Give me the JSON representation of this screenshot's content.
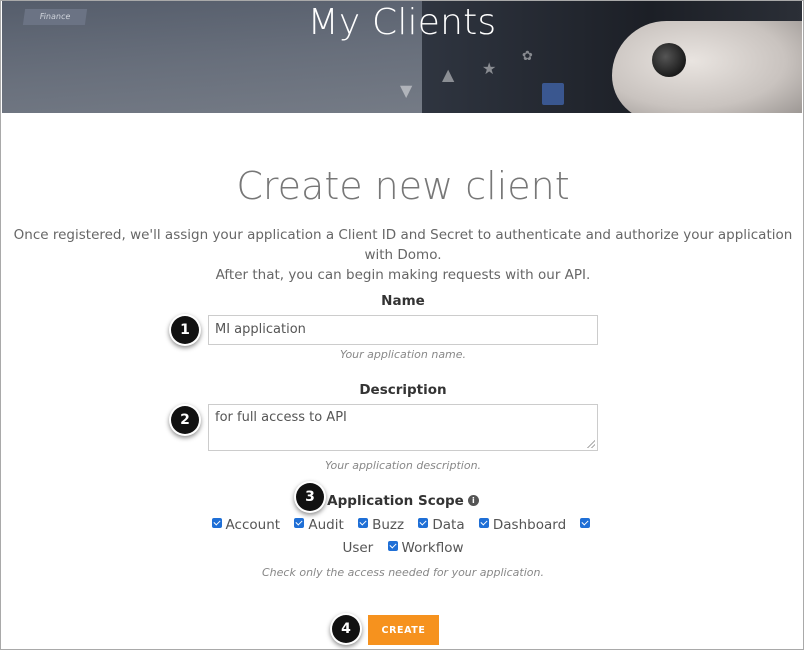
{
  "header": {
    "title": "My Clients",
    "tag": "Finance"
  },
  "form": {
    "title": "Create new client",
    "intro_line1": "Once registered, we'll assign your application a Client ID and Secret to authenticate and authorize your application with Domo.",
    "intro_line2": "After that, you can begin making requests with our API.",
    "name": {
      "label": "Name",
      "value": "MI application",
      "hint": "Your application name."
    },
    "description": {
      "label": "Description",
      "value": "for full access to API",
      "hint": "Your application description."
    },
    "scope": {
      "label": "Application Scope",
      "items": [
        "Account",
        "Audit",
        "Buzz",
        "Data",
        "Dashboard",
        "User",
        "Workflow"
      ],
      "hint": "Check only the access needed for your application."
    },
    "create_label": "CREATE"
  },
  "steps": [
    "1",
    "2",
    "3",
    "4"
  ],
  "colors": {
    "accent": "#f6921e",
    "checkbox": "#1f6fd6"
  }
}
